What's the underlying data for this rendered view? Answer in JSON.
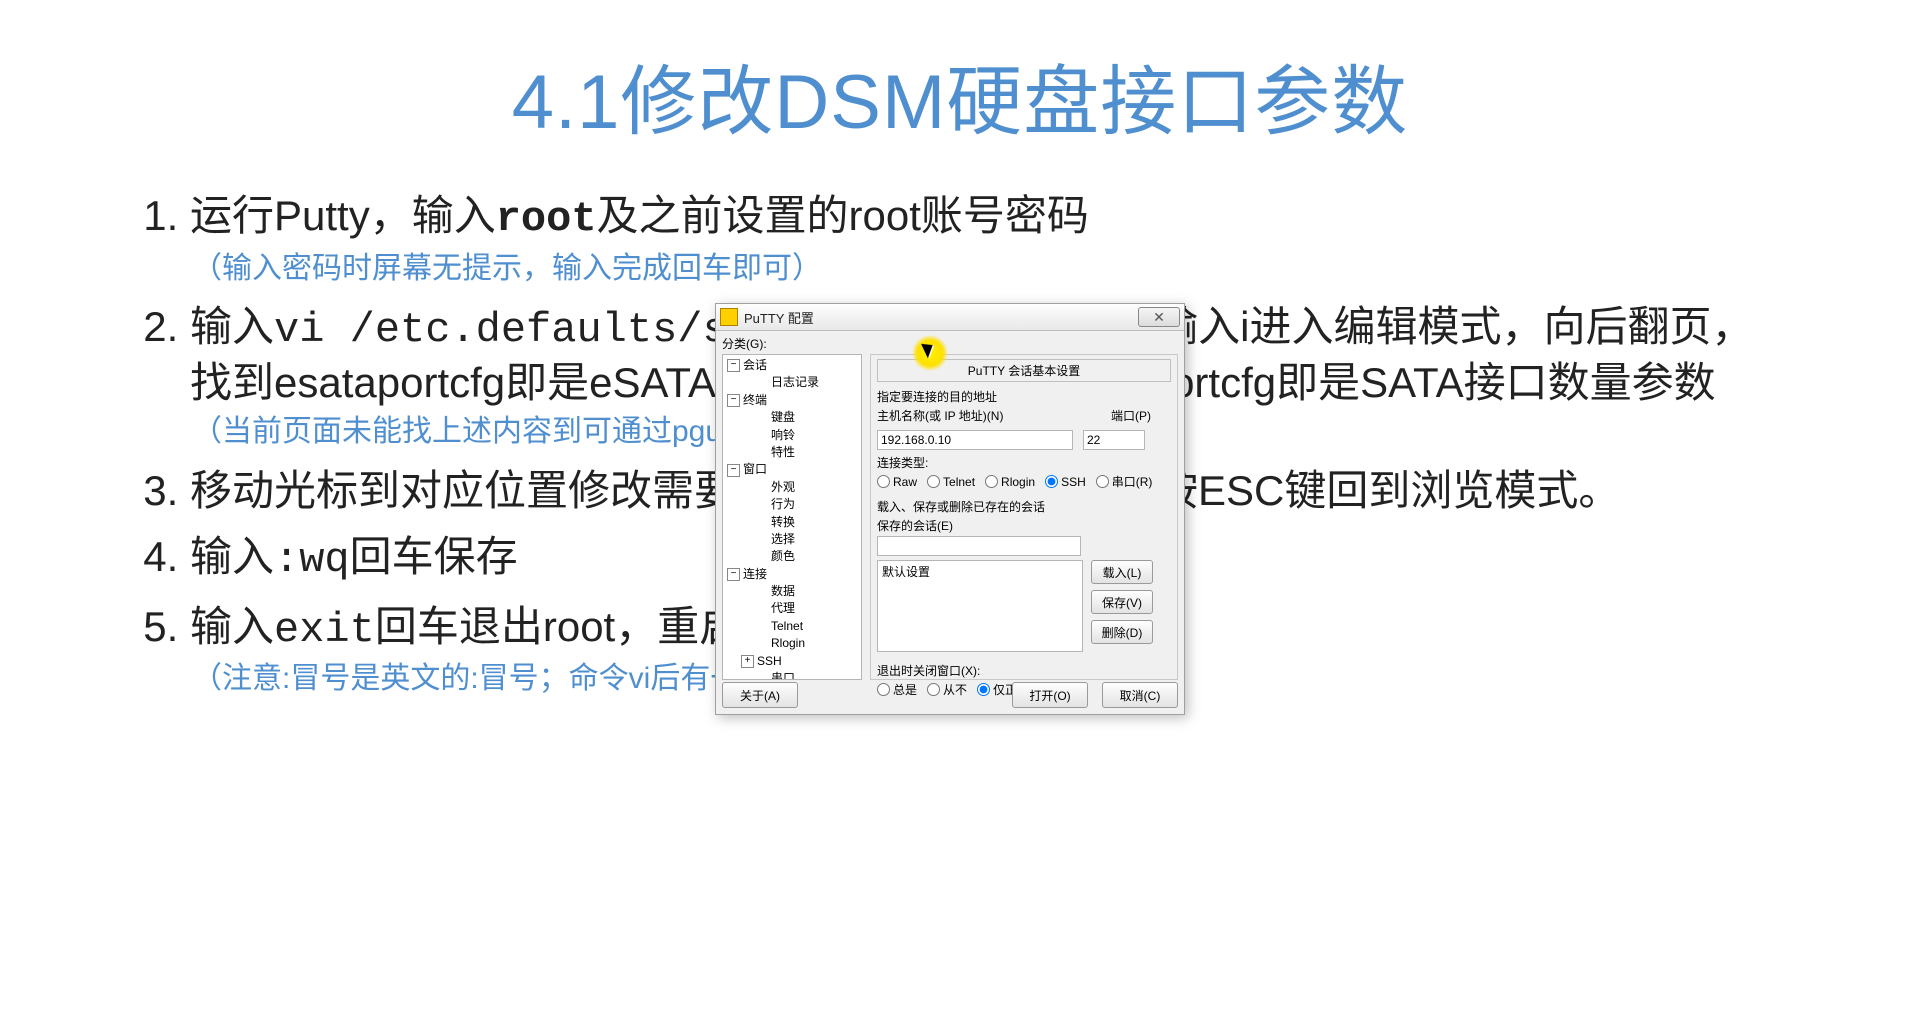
{
  "slide": {
    "title": "4.1修改DSM硬盘接口参数",
    "items": [
      {
        "main_html": "运行Putty，输入<span class='bold mono'>root</span>及之前设置的root账号密码",
        "sub": "（输入密码时屏幕无提示，输入完成回车即可）"
      },
      {
        "main_html": "输入<span class='mono'>vi /etc.defaults/synoinfo.conf</span>回车，输入i进入编辑模式，向后翻页，找到esataportcfg即是eSATA接口数量参数，internalportcfg即是SATA接口数量参数",
        "sub": "（当前页面未能找上述内容到可通过pgup、pgdn翻页查找）"
      },
      {
        "main_html": "移动光标到对应位置修改需要调整的参数，修改完成按ESC键回到浏览模式。",
        "sub": null
      },
      {
        "main_html": "输入<span class='mono'>:wq</span>回车保存",
        "sub": null
      },
      {
        "main_html": "输入<span class='mono'>exit</span>回车退出root，重启系统",
        "sub": "（注意:冒号是英文的:冒号；命令vi后有一个空格）"
      }
    ]
  },
  "putty": {
    "window_title": "PuTTY 配置",
    "category_label": "分类(G):",
    "tree": [
      {
        "d": 0,
        "exp": "−",
        "label": "会话"
      },
      {
        "d": 2,
        "exp": "",
        "label": "日志记录"
      },
      {
        "d": 0,
        "exp": "−",
        "label": "终端"
      },
      {
        "d": 2,
        "exp": "",
        "label": "键盘"
      },
      {
        "d": 2,
        "exp": "",
        "label": "响铃"
      },
      {
        "d": 2,
        "exp": "",
        "label": "特性"
      },
      {
        "d": 0,
        "exp": "−",
        "label": "窗口"
      },
      {
        "d": 2,
        "exp": "",
        "label": "外观"
      },
      {
        "d": 2,
        "exp": "",
        "label": "行为"
      },
      {
        "d": 2,
        "exp": "",
        "label": "转换"
      },
      {
        "d": 2,
        "exp": "",
        "label": "选择"
      },
      {
        "d": 2,
        "exp": "",
        "label": "颜色"
      },
      {
        "d": 0,
        "exp": "−",
        "label": "连接"
      },
      {
        "d": 2,
        "exp": "",
        "label": "数据"
      },
      {
        "d": 2,
        "exp": "",
        "label": "代理"
      },
      {
        "d": 2,
        "exp": "",
        "label": "Telnet"
      },
      {
        "d": 2,
        "exp": "",
        "label": "Rlogin"
      },
      {
        "d": 1,
        "exp": "+",
        "label": "SSH"
      },
      {
        "d": 2,
        "exp": "",
        "label": "串口"
      }
    ],
    "panel_title": "PuTTY 会话基本设置",
    "dest_label": "指定要连接的目的地址",
    "host_label": "主机名称(或 IP 地址)(N)",
    "port_label": "端口(P)",
    "host_value": "192.168.0.10",
    "port_value": "22",
    "conn_type_label": "连接类型:",
    "radios": {
      "raw": "Raw",
      "telnet": "Telnet",
      "rlogin": "Rlogin",
      "ssh": "SSH",
      "serial": "串口(R)"
    },
    "radios_selected": "ssh",
    "sessions_label": "载入、保存或删除已存在的会话",
    "saved_label": "保存的会话(E)",
    "saved_value": "",
    "default_session": "默认设置",
    "btn_load": "载入(L)",
    "btn_save": "保存(V)",
    "btn_delete": "删除(D)",
    "exit_label": "退出时关闭窗口(X):",
    "exit_opts": {
      "always": "总是",
      "never": "从不",
      "clean": "仅正常退出"
    },
    "exit_selected": "clean",
    "btn_about": "关于(A)",
    "btn_open": "打开(O)",
    "btn_cancel": "取消(C)"
  }
}
